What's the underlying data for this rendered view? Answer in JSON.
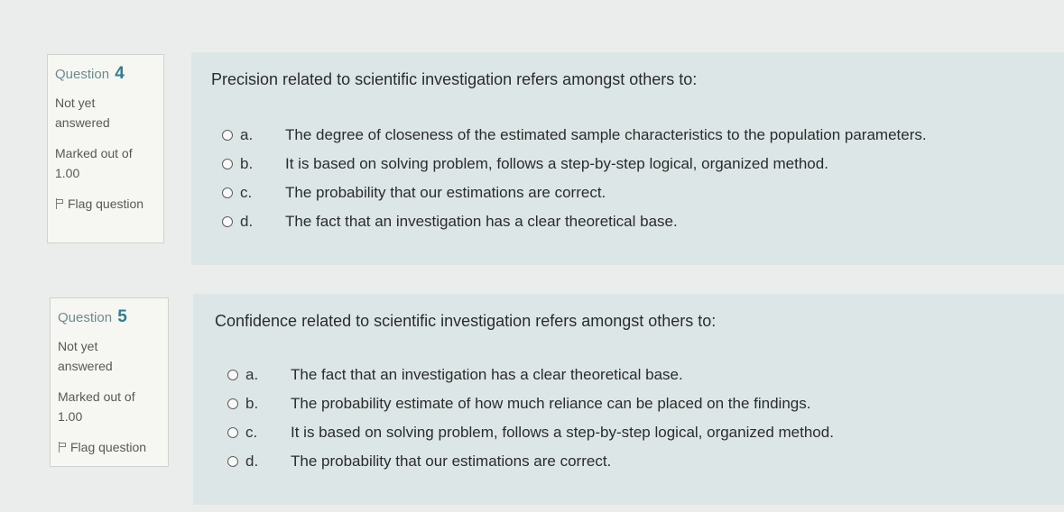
{
  "questions": [
    {
      "label": "Question",
      "number": "4",
      "state_line1": "Not yet",
      "state_line2": "answered",
      "grade_line1": "Marked out of",
      "grade_line2": "1.00",
      "flag_label": "Flag question",
      "text": "Precision related to scientific investigation refers amongst others to:",
      "options": [
        {
          "letter": "a.",
          "text": "The degree of closeness of the estimated sample characteristics to the population parameters."
        },
        {
          "letter": "b.",
          "text": "It is based on solving problem, follows a step-by-step logical, organized method."
        },
        {
          "letter": "c.",
          "text": "The probability that our estimations are correct."
        },
        {
          "letter": "d.",
          "text": "The fact that an investigation has a clear theoretical base."
        }
      ]
    },
    {
      "label": "Question",
      "number": "5",
      "state_line1": "Not yet",
      "state_line2": "answered",
      "grade_line1": "Marked out of",
      "grade_line2": "1.00",
      "flag_label": "Flag question",
      "text": "Confidence related to scientific investigation refers amongst others to:",
      "options": [
        {
          "letter": "a.",
          "text": "The fact that an investigation has a clear theoretical base."
        },
        {
          "letter": "b.",
          "text": "The probability estimate of how much reliance can be placed on the findings."
        },
        {
          "letter": "c.",
          "text": "It is based on solving problem, follows a step-by-step logical, organized method."
        },
        {
          "letter": "d.",
          "text": "The probability that our estimations are correct."
        }
      ]
    }
  ],
  "colors": {
    "info_bg": "#f6f7f2",
    "content_bg": "#dde6e7",
    "question_number": "#2c7e93"
  }
}
